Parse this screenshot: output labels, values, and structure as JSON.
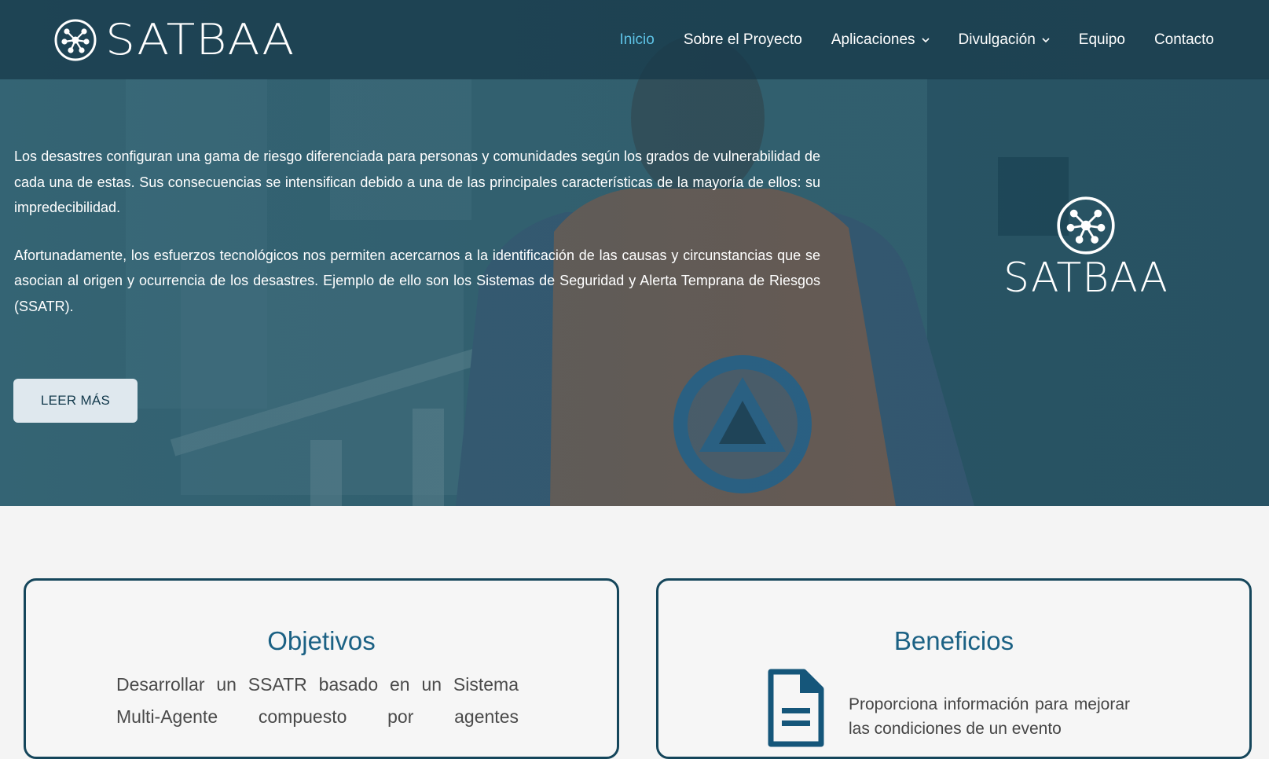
{
  "header": {
    "brand": "SATBAA",
    "nav": [
      {
        "label": "Inicio",
        "active": true,
        "dropdown": false
      },
      {
        "label": "Sobre el Proyecto",
        "active": false,
        "dropdown": false
      },
      {
        "label": "Aplicaciones",
        "active": false,
        "dropdown": true
      },
      {
        "label": "Divulgación",
        "active": false,
        "dropdown": true
      },
      {
        "label": "Equipo",
        "active": false,
        "dropdown": false
      },
      {
        "label": "Contacto",
        "active": false,
        "dropdown": false
      }
    ]
  },
  "hero": {
    "paragraph1": "Los desastres configuran una gama de riesgo diferenciada para personas y comunidades según los grados de vulnerabilidad de cada una de estas. Sus consecuencias se intensifican debido a una de las principales características de la mayoría de ellos: su impredecibilidad.",
    "paragraph2": "Afortunadamente, los esfuerzos tecnológicos nos permiten acercarnos a la identificación de las causas y circunstancias que se asocian al origen y ocurrencia de los desastres. Ejemplo de ello son los Sistemas de Seguridad y Alerta Temprana de Riesgos (SSATR).",
    "cta": "LEER MÁS",
    "logo_word": "SATBAA"
  },
  "cards": {
    "left": {
      "title": "Objetivos",
      "text": "Desarrollar un SSATR basado en un Sistema Multi-Agente compuesto por agentes"
    },
    "right": {
      "title": "Beneficios",
      "text": "Proporciona información para mejorar las condiciones de un evento"
    }
  },
  "colors": {
    "nav_active": "#5ec3e6",
    "card_border": "#15465b",
    "card_title": "#1b6184",
    "cta_bg": "#dfe8ee"
  },
  "icons": {
    "brand": "network-node-icon",
    "dropdown": "chevron-down-icon",
    "benefit": "document-icon"
  }
}
